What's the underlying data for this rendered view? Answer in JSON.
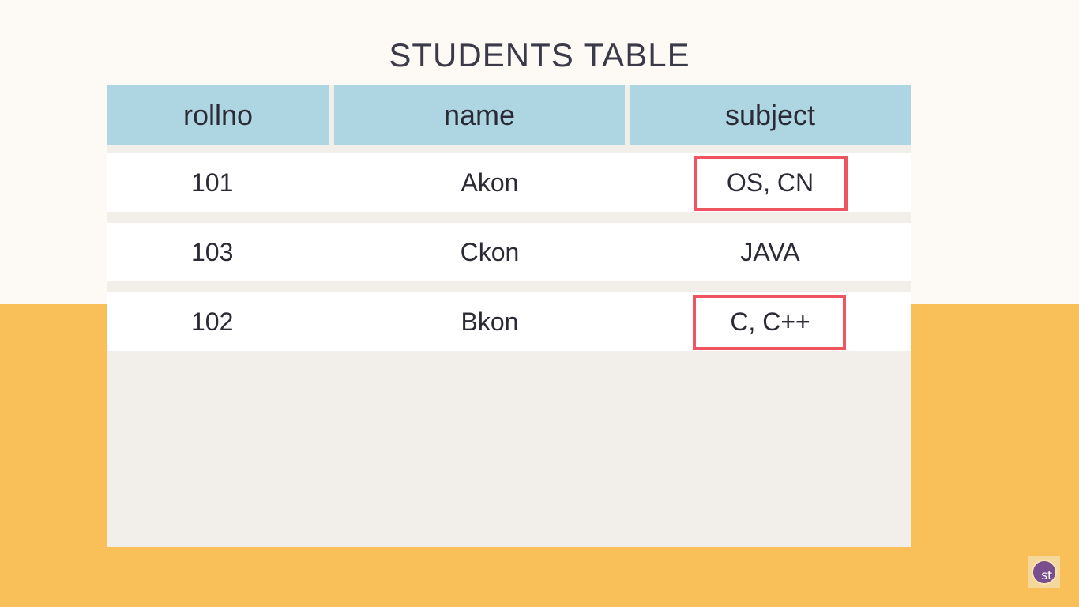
{
  "title": "STUDENTS TABLE",
  "table": {
    "columns": [
      "rollno",
      "name",
      "subject"
    ],
    "rows": [
      {
        "rollno": "101",
        "name": "Akon",
        "subject": "OS, CN",
        "highlighted": true
      },
      {
        "rollno": "103",
        "name": "Ckon",
        "subject": "JAVA",
        "highlighted": false
      },
      {
        "rollno": "102",
        "name": "Bkon",
        "subject": "C, C++",
        "highlighted": true
      }
    ]
  },
  "logo": {
    "text": "st"
  },
  "colors": {
    "background_top": "#fdf9f4",
    "background_bottom": "#f9c059",
    "header": "#add5e2",
    "highlight": "#ee5560"
  }
}
